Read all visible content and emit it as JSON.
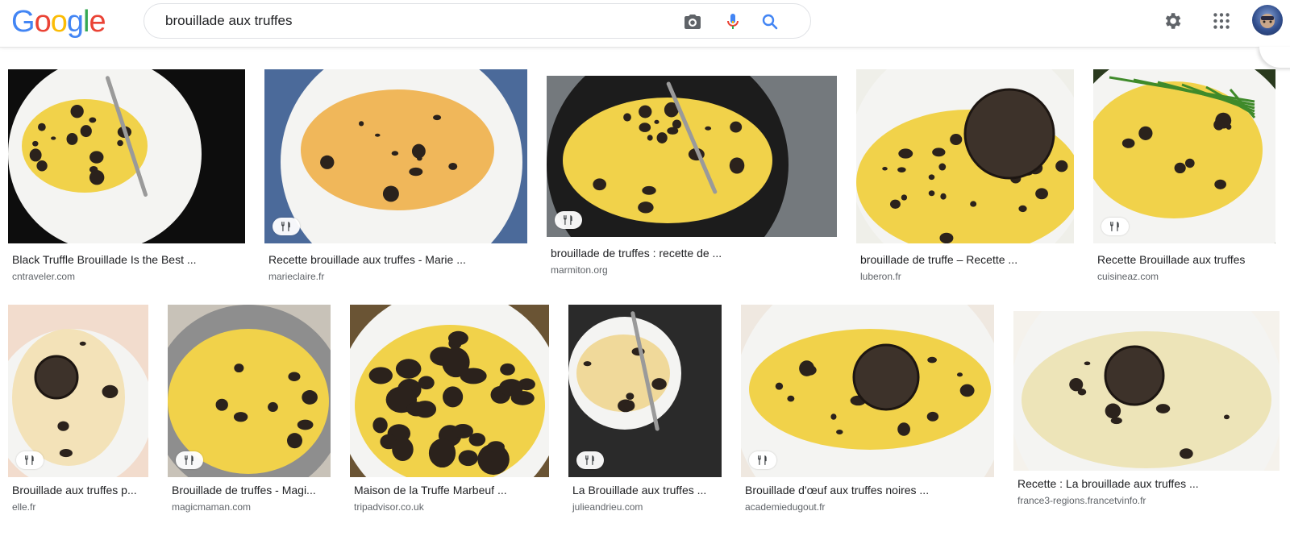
{
  "header": {
    "logo_letters": [
      {
        "char": "G",
        "color": "#4285F4"
      },
      {
        "char": "o",
        "color": "#EA4335"
      },
      {
        "char": "o",
        "color": "#FBBC05"
      },
      {
        "char": "g",
        "color": "#4285F4"
      },
      {
        "char": "l",
        "color": "#34A853"
      },
      {
        "char": "e",
        "color": "#EA4335"
      }
    ],
    "search_value": "brouillade aux truffes",
    "icons": [
      "camera-icon",
      "microphone-icon",
      "search-icon",
      "gear-icon",
      "apps-icon",
      "avatar"
    ]
  },
  "results": [
    {
      "title": "Black Truffle Brouillade Is the Best ...",
      "source": "cntraveler.com",
      "recipe_badge": false
    },
    {
      "title": "Recette brouillade aux truffes - Marie ...",
      "source": "marieclaire.fr",
      "recipe_badge": true
    },
    {
      "title": "brouillade de truffes : recette de ...",
      "source": "marmiton.org",
      "recipe_badge": true
    },
    {
      "title": "brouillade de truffe – Recette ...",
      "source": "luberon.fr",
      "recipe_badge": false
    },
    {
      "title": "Recette Brouillade aux truffes",
      "source": "cuisineaz.com",
      "recipe_badge": true
    },
    {
      "title": "Brouillade aux truffes p...",
      "source": "elle.fr",
      "recipe_badge": true
    },
    {
      "title": "Brouillade de truffes - Magi...",
      "source": "magicmaman.com",
      "recipe_badge": true
    },
    {
      "title": "Maison de la Truffe Marbeuf ...",
      "source": "tripadvisor.co.uk",
      "recipe_badge": false
    },
    {
      "title": "La Brouillade aux truffes ...",
      "source": "julieandrieu.com",
      "recipe_badge": true
    },
    {
      "title": "Brouillade d'œuf aux truffes noires ...",
      "source": "academiedugout.fr",
      "recipe_badge": true
    },
    {
      "title": "Recette : La brouillade aux truffes ...",
      "source": "france3-regions.francetvinfo.fr",
      "recipe_badge": false
    }
  ],
  "colors": {
    "egg_yellow": "#f1d24a",
    "truffle": "#2b221c",
    "plate": "#f4f4f2",
    "link_blue": "#4285F4"
  }
}
